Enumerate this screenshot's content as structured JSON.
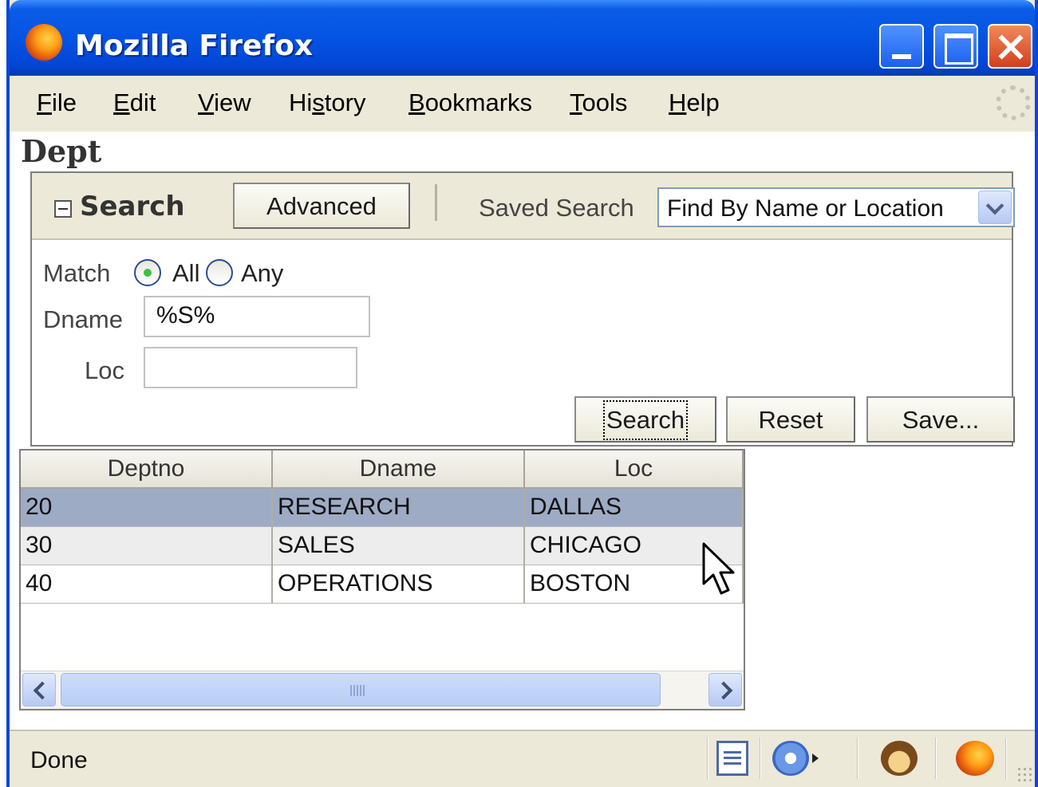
{
  "window": {
    "title": "Mozilla Firefox"
  },
  "menu": {
    "file": "File",
    "file_acc": "F",
    "file_rest": "ile",
    "edit": "Edit",
    "edit_acc": "E",
    "edit_rest": "dit",
    "view_acc": "V",
    "view_rest": "iew",
    "history_pre": "Hi",
    "history_acc": "s",
    "history_rest": "tory",
    "bookmarks_acc": "B",
    "bookmarks_rest": "ookmarks",
    "tools_acc": "T",
    "tools_rest": "ools",
    "help_acc": "H",
    "help_rest": "elp"
  },
  "page": {
    "title": "Dept"
  },
  "search_panel": {
    "title": "Search",
    "advanced_label": "Advanced",
    "saved_search_label": "Saved Search",
    "saved_search_value": "Find By Name or Location",
    "match_label": "Match",
    "match_options": [
      "All",
      "Any"
    ],
    "match_selected": "All",
    "dname_label": "Dname",
    "dname_value": "%S%",
    "loc_label": "Loc",
    "loc_value": "",
    "search_button": "Search",
    "reset_button": "Reset",
    "save_button": "Save..."
  },
  "table": {
    "columns": [
      "Deptno",
      "Dname",
      "Loc"
    ],
    "rows": [
      {
        "deptno": "20",
        "dname": "RESEARCH",
        "loc": "DALLAS",
        "selected": true
      },
      {
        "deptno": "30",
        "dname": "SALES",
        "loc": "CHICAGO"
      },
      {
        "deptno": "40",
        "dname": "OPERATIONS",
        "loc": "BOSTON"
      }
    ]
  },
  "statusbar": {
    "text": "Done"
  },
  "icons": {
    "app": "firefox-icon",
    "minimize": "minimize-icon",
    "maximize": "maximize-icon",
    "close": "close-icon",
    "throbber": "throbber-icon",
    "collapse": "collapse-minus-icon",
    "dropdown": "chevron-down-icon",
    "page_report": "page-report-icon",
    "addon": "addon-icon",
    "monkey": "greasemonkey-icon",
    "firefox_status": "firefox-icon"
  },
  "colors": {
    "titlebar": "#0454e3",
    "selected_row": "#9eabc5",
    "alt_row": "#ededed"
  }
}
